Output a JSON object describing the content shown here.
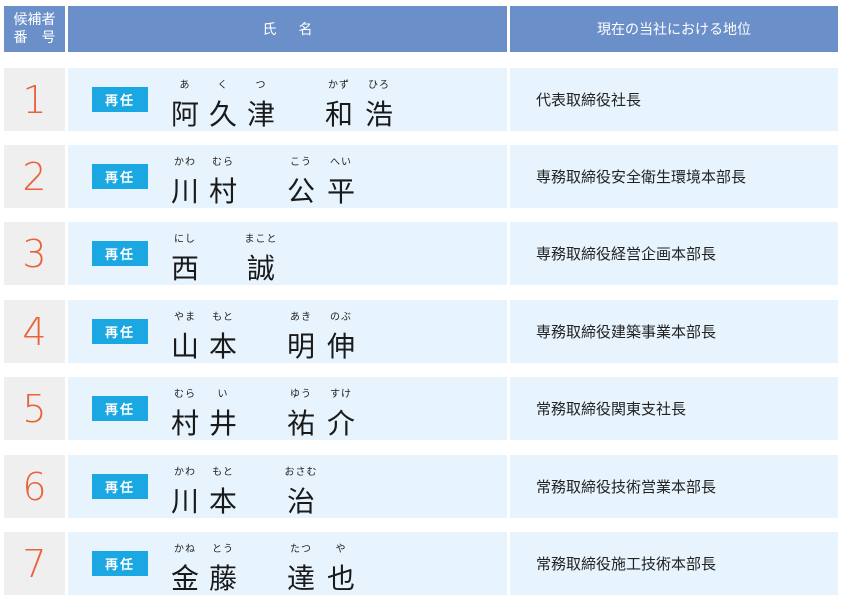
{
  "header": {
    "col_number": "候補者\n番　号",
    "col_name": "氏名",
    "col_position": "現在の当社における地位"
  },
  "badge_label": "再任",
  "rows": [
    {
      "number": "1",
      "position": "代表取締役社長",
      "glyphs": [
        {
          "k": "阿",
          "f": "あ"
        },
        {
          "k": "久",
          "f": "く"
        },
        {
          "k": "津",
          "f": "つ"
        },
        {
          "k": "和",
          "f": "かず"
        },
        {
          "k": "浩",
          "f": "ひろ"
        }
      ]
    },
    {
      "number": "2",
      "position": "専務取締役安全衛生環境本部長",
      "glyphs": [
        {
          "k": "川",
          "f": "かわ"
        },
        {
          "k": "村",
          "f": "むら"
        },
        {
          "k": "公",
          "f": "こう"
        },
        {
          "k": "平",
          "f": "へい"
        }
      ]
    },
    {
      "number": "3",
      "position": "専務取締役経営企画本部長",
      "glyphs": [
        {
          "k": "西",
          "f": "にし"
        },
        {
          "k": "誠",
          "f": "まこと"
        }
      ]
    },
    {
      "number": "4",
      "position": "専務取締役建築事業本部長",
      "glyphs": [
        {
          "k": "山",
          "f": "やま"
        },
        {
          "k": "本",
          "f": "もと"
        },
        {
          "k": "明",
          "f": "あき"
        },
        {
          "k": "伸",
          "f": "のぶ"
        }
      ]
    },
    {
      "number": "5",
      "position": "常務取締役関東支社長",
      "glyphs": [
        {
          "k": "村",
          "f": "むら"
        },
        {
          "k": "井",
          "f": "い"
        },
        {
          "k": "祐",
          "f": "ゆう"
        },
        {
          "k": "介",
          "f": "すけ"
        }
      ]
    },
    {
      "number": "6",
      "position": "常務取締役技術営業本部長",
      "glyphs": [
        {
          "k": "川",
          "f": "かわ"
        },
        {
          "k": "本",
          "f": "もと"
        },
        {
          "k": "治",
          "f": "おさむ"
        }
      ]
    },
    {
      "number": "7",
      "position": "常務取締役施工技術本部長",
      "glyphs": [
        {
          "k": "金",
          "f": "かね"
        },
        {
          "k": "藤",
          "f": "とう"
        },
        {
          "k": "達",
          "f": "たつ"
        },
        {
          "k": "也",
          "f": "や"
        }
      ]
    }
  ]
}
